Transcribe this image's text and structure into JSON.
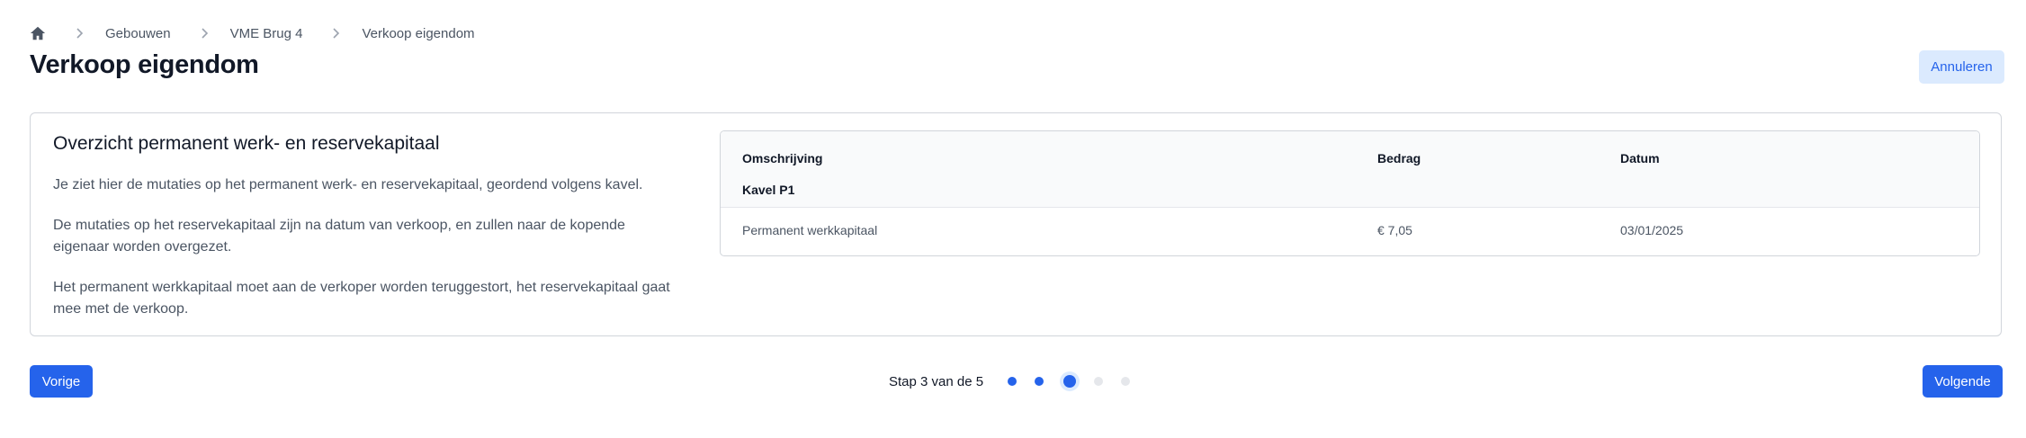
{
  "breadcrumb": {
    "items": [
      "Gebouwen",
      "VME Brug 4",
      "Verkoop eigendom"
    ]
  },
  "header": {
    "title": "Verkoop eigendom",
    "cancel_label": "Annuleren"
  },
  "overview": {
    "title": "Overzicht permanent werk- en reservekapitaal",
    "paragraphs": [
      "Je ziet hier de mutaties op het permanent werk- en reservekapitaal, geordend volgens kavel.",
      "De mutaties op het reservekapitaal zijn na datum van verkoop, en zullen naar de kopende eigenaar worden overgezet.",
      "Het permanent werkkapitaal moet aan de verkoper worden teruggestort, het reservekapitaal gaat mee met de verkoop."
    ]
  },
  "table": {
    "columns": [
      "Omschrijving",
      "Bedrag",
      "Datum"
    ],
    "group_label": "Kavel P1",
    "rows": [
      {
        "description": "Permanent werkkapitaal",
        "amount": "€ 7,05",
        "date": "03/01/2025"
      }
    ]
  },
  "footer": {
    "prev_label": "Vorige",
    "next_label": "Volgende",
    "step_text": "Stap 3 van de 5",
    "current_step": 3,
    "total_steps": 5
  },
  "colors": {
    "primary": "#2563eb",
    "primary_light": "#dbeafe",
    "border": "#d1d5db"
  }
}
